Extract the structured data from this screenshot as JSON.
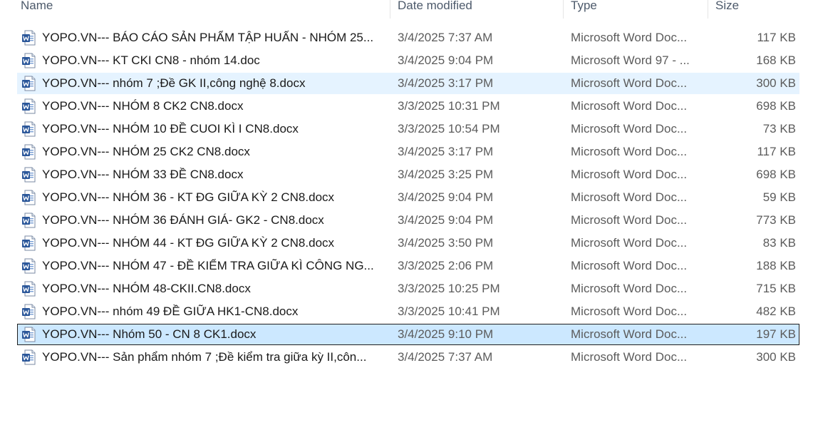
{
  "columns": {
    "name": "Name",
    "date": "Date modified",
    "type": "Type",
    "size": "Size"
  },
  "files": [
    {
      "name": "YOPO.VN--- BÁO CÁO SẢN PHẨM TẬP HUẤN - NHÓM 25...",
      "date": "3/4/2025 7:37 AM",
      "type": "Microsoft Word Doc...",
      "size": "117 KB",
      "state": "normal"
    },
    {
      "name": "YOPO.VN--- KT CKI CN8 - nhóm 14.doc",
      "date": "3/4/2025 9:04 PM",
      "type": "Microsoft Word 97 - ...",
      "size": "168 KB",
      "state": "normal"
    },
    {
      "name": "YOPO.VN--- nhóm 7 ;Đề GK II,công nghệ 8.docx",
      "date": "3/4/2025 3:17 PM",
      "type": "Microsoft Word Doc...",
      "size": "300 KB",
      "state": "hover"
    },
    {
      "name": "YOPO.VN--- NHÓM 8 CK2 CN8.docx",
      "date": "3/3/2025 10:31 PM",
      "type": "Microsoft Word Doc...",
      "size": "698 KB",
      "state": "normal"
    },
    {
      "name": "YOPO.VN--- NHÓM 10 ĐỀ CUOI KÌ I CN8.docx",
      "date": "3/3/2025 10:54 PM",
      "type": "Microsoft Word Doc...",
      "size": "73 KB",
      "state": "normal"
    },
    {
      "name": "YOPO.VN--- NHÓM 25 CK2 CN8.docx",
      "date": "3/4/2025 3:17 PM",
      "type": "Microsoft Word Doc...",
      "size": "117 KB",
      "state": "normal"
    },
    {
      "name": "YOPO.VN--- NHÓM 33 ĐỀ CN8.docx",
      "date": "3/4/2025 3:25 PM",
      "type": "Microsoft Word Doc...",
      "size": "698 KB",
      "state": "normal"
    },
    {
      "name": "YOPO.VN--- NHÓM 36 -  KT ĐG GIỮA KỲ 2 CN8.docx",
      "date": "3/4/2025 9:04 PM",
      "type": "Microsoft Word Doc...",
      "size": "59 KB",
      "state": "normal"
    },
    {
      "name": "YOPO.VN--- NHÓM 36 ĐÁNH GIÁ- GK2 - CN8.docx",
      "date": "3/4/2025 9:04 PM",
      "type": "Microsoft Word Doc...",
      "size": "773 KB",
      "state": "normal"
    },
    {
      "name": "YOPO.VN--- NHÓM 44 -  KT ĐG GIỮA KỲ 2 CN8.docx",
      "date": "3/4/2025 3:50 PM",
      "type": "Microsoft Word Doc...",
      "size": "83 KB",
      "state": "normal"
    },
    {
      "name": "YOPO.VN--- NHÓM 47 - ĐỀ KIỂM TRA GIỮA KÌ CÔNG NG...",
      "date": "3/3/2025 2:06 PM",
      "type": "Microsoft Word Doc...",
      "size": "188 KB",
      "state": "normal"
    },
    {
      "name": "YOPO.VN--- NHÓM 48-CKII.CN8.docx",
      "date": "3/3/2025 10:25 PM",
      "type": "Microsoft Word Doc...",
      "size": "715 KB",
      "state": "normal"
    },
    {
      "name": "YOPO.VN--- nhóm 49 ĐỀ GIỮA HK1-CN8.docx",
      "date": "3/3/2025 10:41 PM",
      "type": "Microsoft Word Doc...",
      "size": "482 KB",
      "state": "normal"
    },
    {
      "name": "YOPO.VN--- Nhóm 50 - CN 8 CK1.docx",
      "date": "3/4/2025 9:10 PM",
      "type": "Microsoft Word Doc...",
      "size": "197 KB",
      "state": "selected"
    },
    {
      "name": "YOPO.VN--- Sản phẩm nhóm 7 ;Đề kiểm tra giữa kỳ II,côn...",
      "date": "3/4/2025 7:37 AM",
      "type": "Microsoft Word Doc...",
      "size": "300 KB",
      "state": "normal"
    }
  ],
  "icon": "word-document-icon",
  "colors": {
    "hover_bg": "#e5f3ff",
    "selected_bg": "#cce8ff",
    "word_blue": "#2b579a"
  }
}
